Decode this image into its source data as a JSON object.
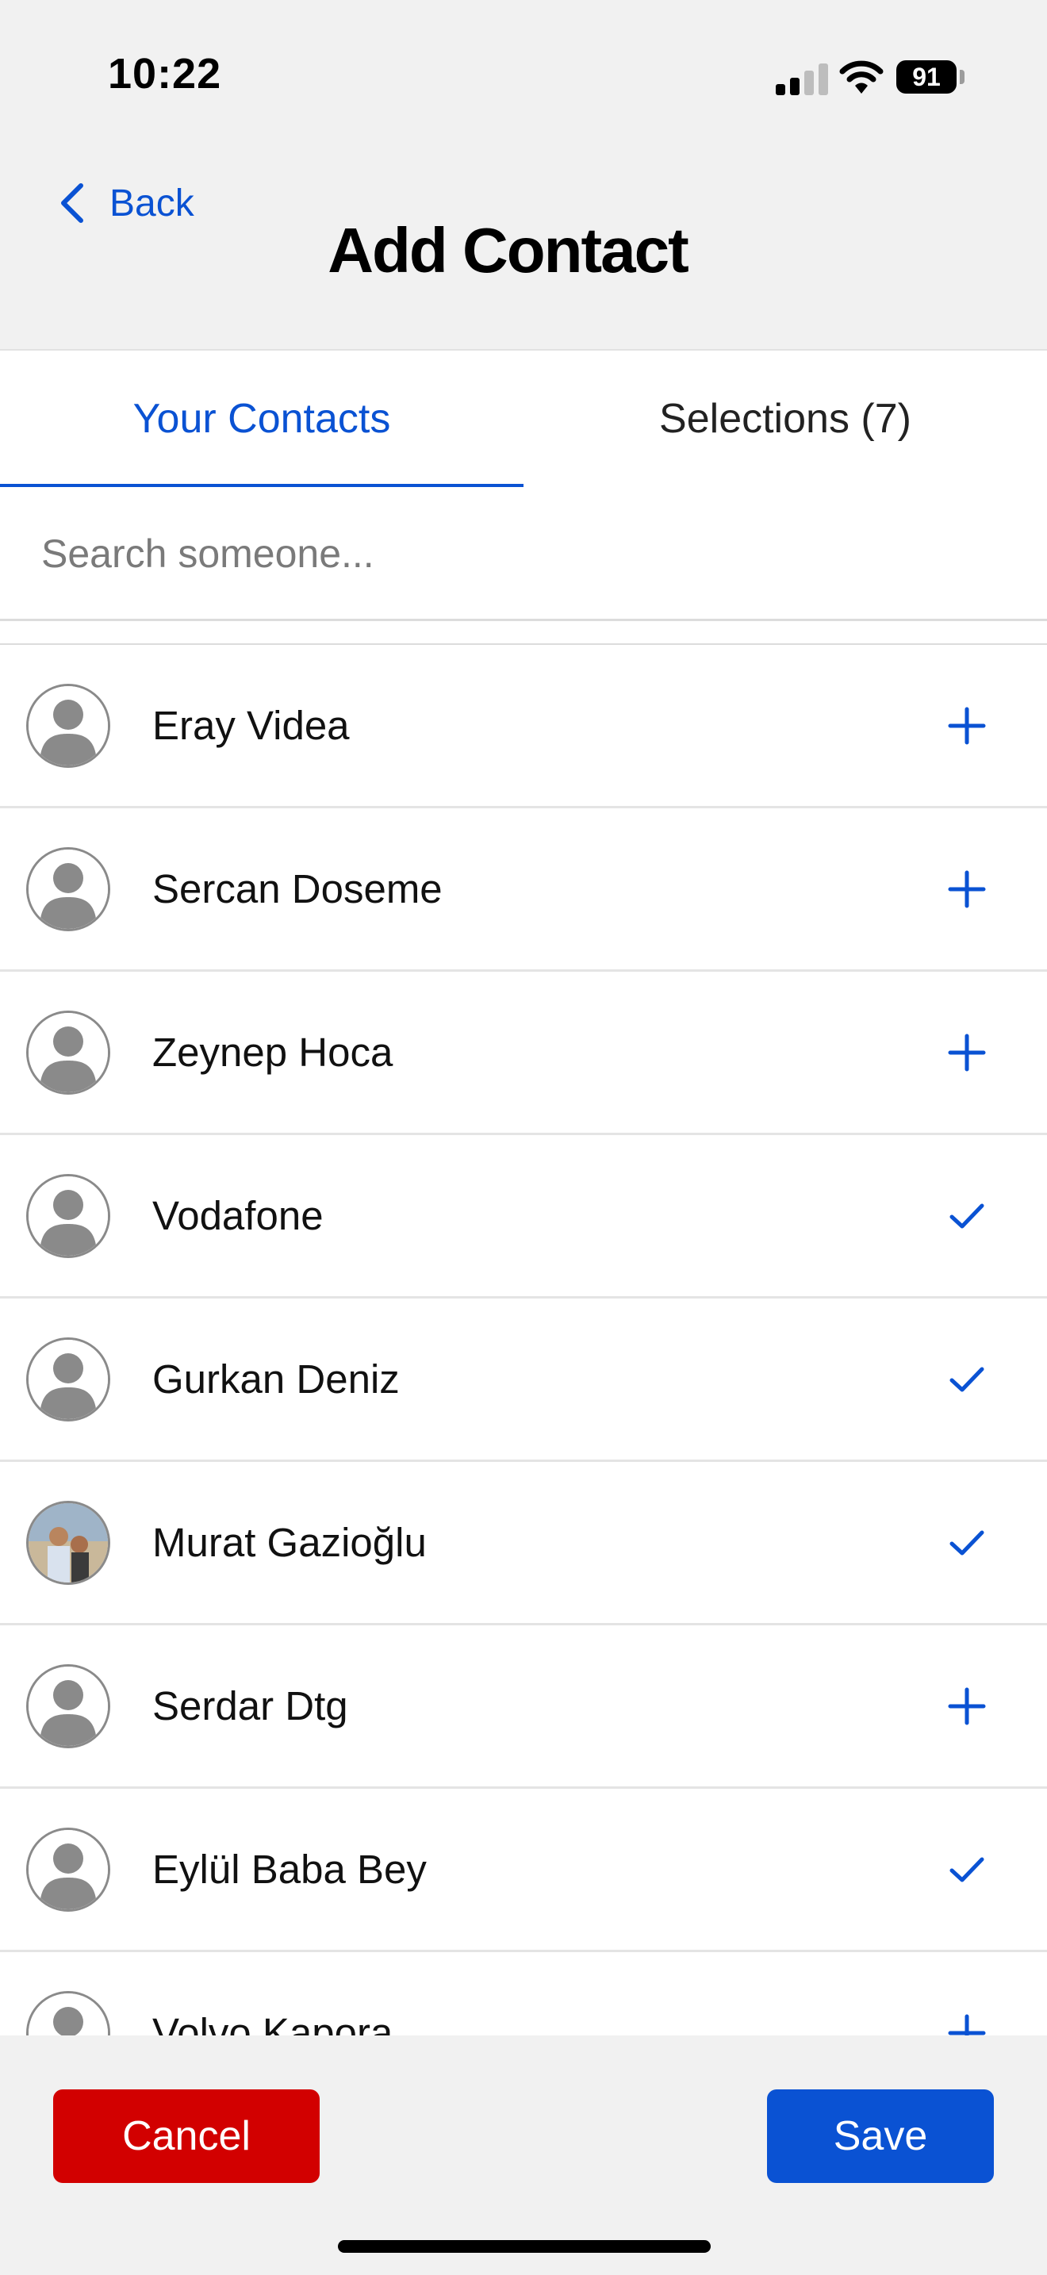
{
  "status_bar": {
    "time": "10:22",
    "battery": "91",
    "icons": [
      "signal-icon",
      "wifi-icon",
      "battery-icon"
    ]
  },
  "nav": {
    "back_label": "Back",
    "title": "Add Contact"
  },
  "tabs": [
    {
      "label": "Your Contacts",
      "active": true
    },
    {
      "label": "Selections (7)",
      "active": false
    }
  ],
  "search": {
    "placeholder": "Search someone..."
  },
  "contacts": [
    {
      "name": "Eray Videa",
      "status": "add",
      "avatar": "placeholder"
    },
    {
      "name": "Sercan Doseme",
      "status": "add",
      "avatar": "placeholder"
    },
    {
      "name": "Zeynep Hoca",
      "status": "add",
      "avatar": "placeholder"
    },
    {
      "name": "Vodafone",
      "status": "selected",
      "avatar": "placeholder"
    },
    {
      "name": "Gurkan Deniz",
      "status": "selected",
      "avatar": "placeholder"
    },
    {
      "name": "Murat Gazioğlu",
      "status": "selected",
      "avatar": "photo"
    },
    {
      "name": "Serdar Dtg",
      "status": "add",
      "avatar": "placeholder"
    },
    {
      "name": "Eylül Baba Bey",
      "status": "selected",
      "avatar": "placeholder"
    },
    {
      "name": "Volvo Kapora",
      "status": "add",
      "avatar": "placeholder"
    }
  ],
  "footer": {
    "cancel_label": "Cancel",
    "save_label": "Save"
  },
  "colors": {
    "accent": "#0a52d3",
    "danger": "#d20000",
    "background": "#f1f1f1"
  }
}
